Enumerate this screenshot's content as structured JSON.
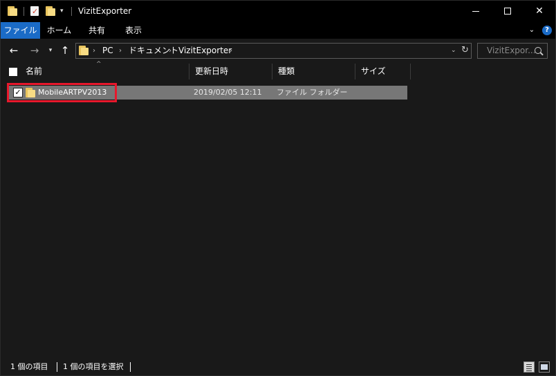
{
  "window": {
    "title": "VizitExporter",
    "qa_dropdown_glyph": "▾",
    "min_glyph": "",
    "close_glyph": "✕"
  },
  "ribbon": {
    "tabs": [
      {
        "label": "ファイル",
        "active": true
      },
      {
        "label": "ホーム",
        "active": false
      },
      {
        "label": "共有",
        "active": false
      },
      {
        "label": "表示",
        "active": false
      }
    ],
    "expand_glyph": "⌄",
    "help_glyph": "?"
  },
  "nav": {
    "back_glyph": "←",
    "forward_glyph": "→",
    "recent_glyph": "▾",
    "up_glyph": "↑",
    "breadcrumb": [
      "PC",
      "ドキュメント",
      "VizitExporter"
    ],
    "crumb_sep": "›",
    "address_dropdown": "⌄",
    "refresh_glyph": "↻",
    "search_placeholder": "VizitExpor..."
  },
  "columns": {
    "sort_glyph": "^",
    "headers": [
      "名前",
      "更新日時",
      "種類",
      "サイズ"
    ]
  },
  "files": [
    {
      "name": "MobileARTPV2013",
      "modified": "2019/02/05 12:11",
      "type": "ファイル フォルダー",
      "size": "",
      "checked": true,
      "check_glyph": "✓"
    }
  ],
  "status": {
    "item_count": "1 個の項目",
    "selected_count": "1 個の項目を選択"
  },
  "colors": {
    "accent": "#1a6bc7",
    "highlight_box": "#e8182c",
    "folder": "#f8dc84"
  }
}
